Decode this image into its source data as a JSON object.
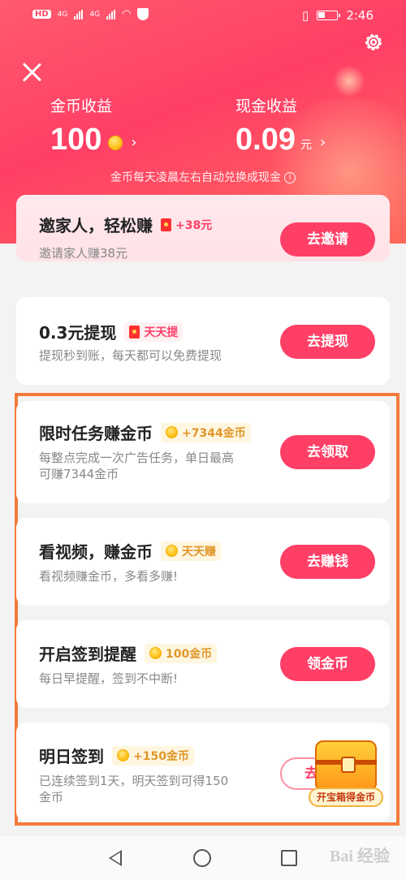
{
  "status_bar": {
    "hd": "HD",
    "net1": "4G",
    "net2": "4G",
    "time": "2:46"
  },
  "header": {
    "coin_label": "金币收益",
    "coin_value": "100",
    "cash_label": "现金收益",
    "cash_value": "0.09",
    "cash_unit": "元",
    "note": "金币每天凌晨左右自动兑换成现金"
  },
  "cards": [
    {
      "title": "邀家人，轻松赚",
      "tag": "+38元",
      "desc": "邀请家人赚38元",
      "button": "去邀请"
    },
    {
      "title": "0.3元提现",
      "tag": "天天提",
      "desc": "提现秒到账，每天都可以免费提现",
      "button": "去提现"
    },
    {
      "title": "限时任务赚金币",
      "tag": "+7344金币",
      "desc_line1": "每整点完成一次广告任务，单日最高",
      "desc_line2": "可赚7344金币",
      "button": "去领取"
    },
    {
      "title": "看视频，赚金币",
      "tag": "天天赚",
      "desc": "看视频赚金币，多看多赚!",
      "button": "去赚钱"
    },
    {
      "title": "开启签到提醒",
      "tag": "100金币",
      "desc": "每日早提醒，签到不中断!",
      "button": "领金币"
    },
    {
      "title": "明日签到",
      "tag": "+150金币",
      "desc_line1": "已连续签到1天，明天签到可得150",
      "desc_line2": "金币",
      "button": "去"
    }
  ],
  "treasure": {
    "label": "开宝箱得金币"
  },
  "watermark": "Bai 经验",
  "colors": {
    "accent": "#ff3f66",
    "highlight_border": "#f47a3a",
    "gold": "#e0962a"
  }
}
